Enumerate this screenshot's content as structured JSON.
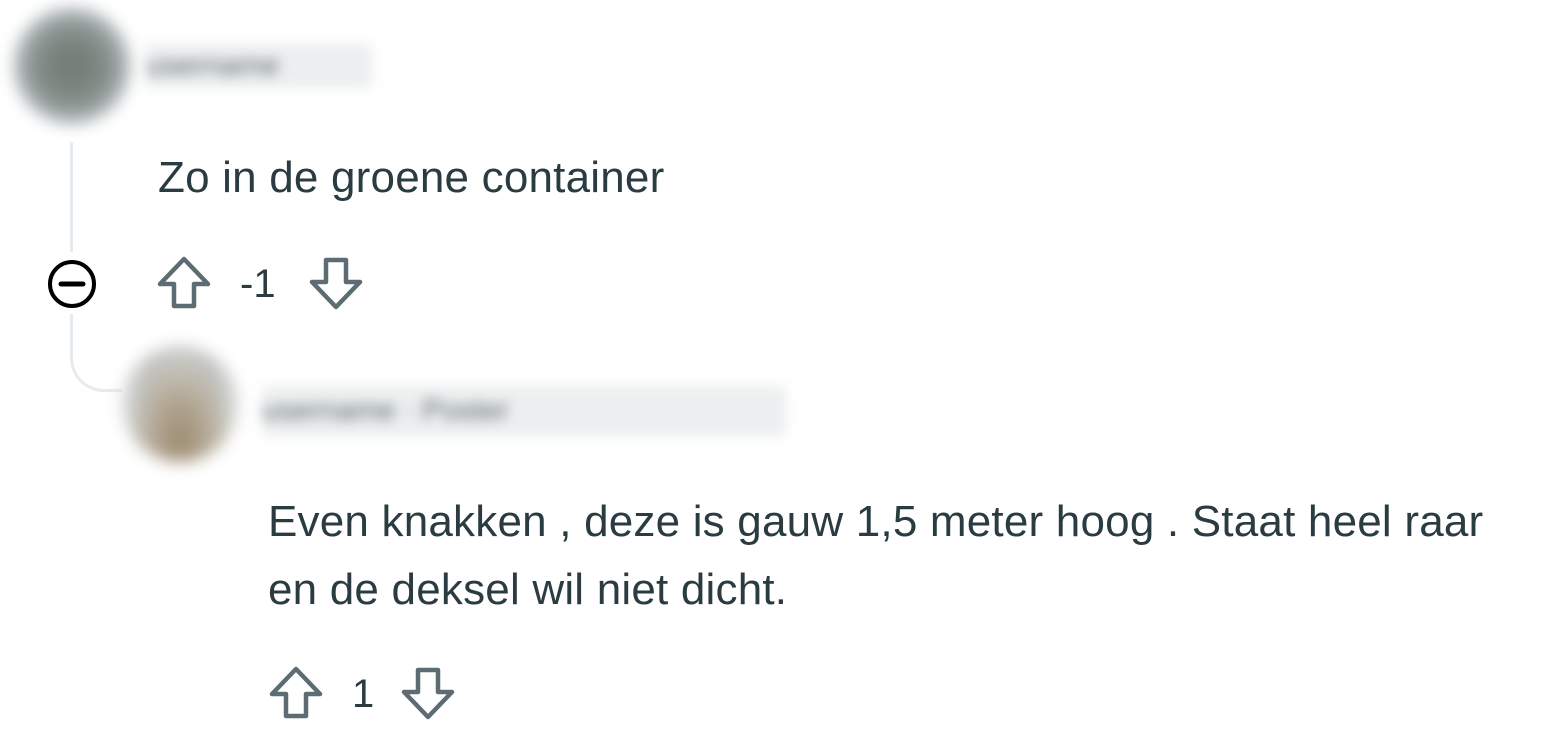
{
  "thread": {
    "comments": [
      {
        "username": "username",
        "body": "Zo in de groene container",
        "score": "-1",
        "avatar_icon": "user-avatar"
      },
      {
        "username": "username · Poster",
        "body": "Even knakken , deze is gauw 1,5 meter hoog . Staat heel raar en de deksel wil niet dicht.",
        "score": "1",
        "avatar_icon": "user-avatar"
      }
    ],
    "collapse_icon": "minus-circle-icon",
    "upvote_icon": "arrow-up-outline-icon",
    "downvote_icon": "arrow-down-outline-icon",
    "colors": {
      "text": "#2a3c42",
      "icon": "#5c6c72",
      "thread_line": "#e5ebee",
      "background": "#ffffff"
    }
  }
}
